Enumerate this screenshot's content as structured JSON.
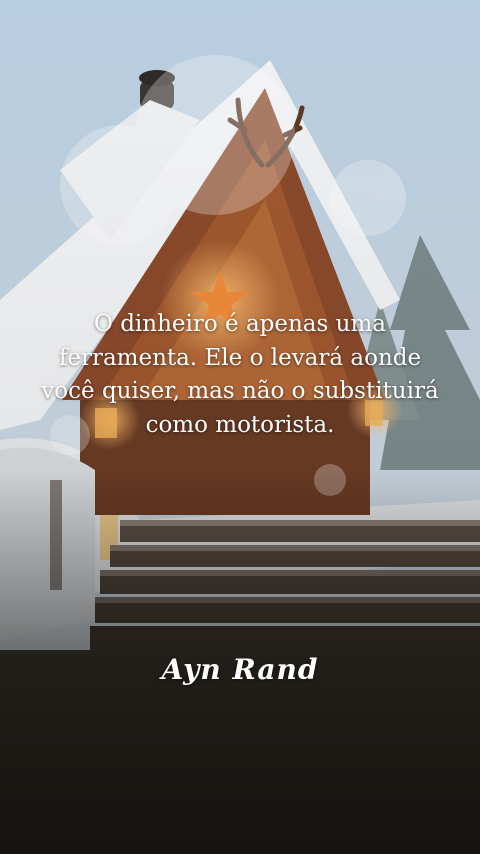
{
  "quote": {
    "text": "O dinheiro é apenas uma ferramenta. Ele o levará aonde você quiser, mas não o substituirá como motorista."
  },
  "author": {
    "signature": "Ayn Rand"
  },
  "colors": {
    "sky": "#b9cfe0",
    "snow": "#eef1f4",
    "roof_wood": "#8a4a2a",
    "warm_light": "#f2a24a",
    "text": "#ffffff"
  }
}
